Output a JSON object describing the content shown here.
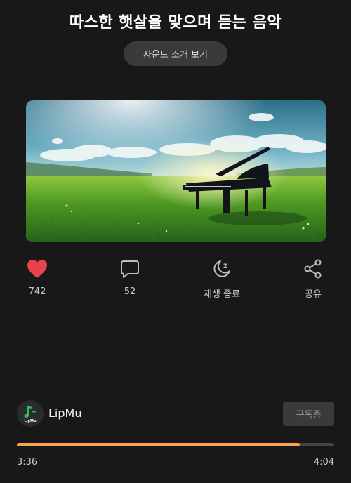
{
  "header": {
    "title": "따스한 햇살을 맞으며 듣는 음악",
    "sound_button_label": "사운드 소개 보기"
  },
  "artwork": {
    "alt": "Grand piano in a sunny green meadow"
  },
  "actions": [
    {
      "icon": "heart-icon",
      "label": "742"
    },
    {
      "icon": "comment-icon",
      "label": "52"
    },
    {
      "icon": "sleep-timer-icon",
      "label": "재생 종료"
    },
    {
      "icon": "share-icon",
      "label": "공유"
    }
  ],
  "channel": {
    "name": "LipMu",
    "avatar_text": "LipMu",
    "subscribe_label": "구독중"
  },
  "player": {
    "elapsed": "3:36",
    "duration": "4:04",
    "progress": 0.891
  },
  "colors": {
    "background": "#181818",
    "accent": "#f5a54a",
    "heart": "#e8424e",
    "logo_green": "#2fbf57"
  }
}
